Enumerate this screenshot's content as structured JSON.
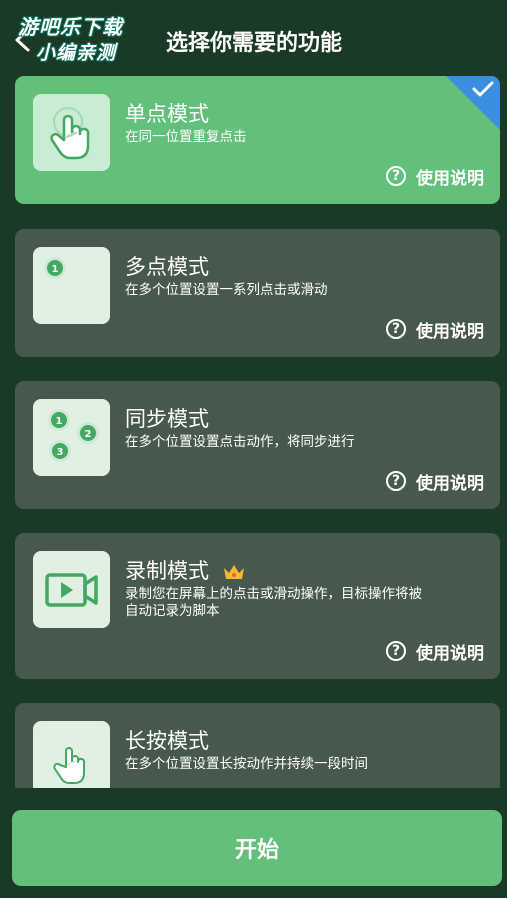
{
  "header": {
    "back_icon": "chevron-left-icon",
    "watermark_line1": "游吧乐下载",
    "watermark_line2": "小编亲测",
    "title": "选择你需要的功能"
  },
  "modes": [
    {
      "name": "单点模式",
      "desc": "在同一位置重复点击",
      "help": "使用说明",
      "selected": true,
      "icon": "tap-finger-icon"
    },
    {
      "name": "多点模式",
      "desc": "在多个位置设置一系列点击或滑动",
      "help": "使用说明",
      "selected": false,
      "icon": "multi-point-icon",
      "badges": [
        "1"
      ]
    },
    {
      "name": "同步模式",
      "desc": "在多个位置设置点击动作，将同步进行",
      "help": "使用说明",
      "selected": false,
      "icon": "sync-points-icon",
      "badges": [
        "1",
        "2",
        "3"
      ]
    },
    {
      "name": "录制模式",
      "desc": "录制您在屏幕上的点击或滑动操作，目标操作将被自动记录为脚本",
      "help": "使用说明",
      "selected": false,
      "icon": "video-record-icon",
      "premium_icon": "crown-icon"
    },
    {
      "name": "长按模式",
      "desc": "在多个位置设置长按动作并持续一段时间",
      "selected": false,
      "icon": "long-press-finger-icon"
    }
  ],
  "start_button": "开始",
  "colors": {
    "background": "#1b3a25",
    "card": "#47594c",
    "accent_green": "#62c07a",
    "selected_corner": "#3b8fe0",
    "icon_green": "#43a862"
  }
}
